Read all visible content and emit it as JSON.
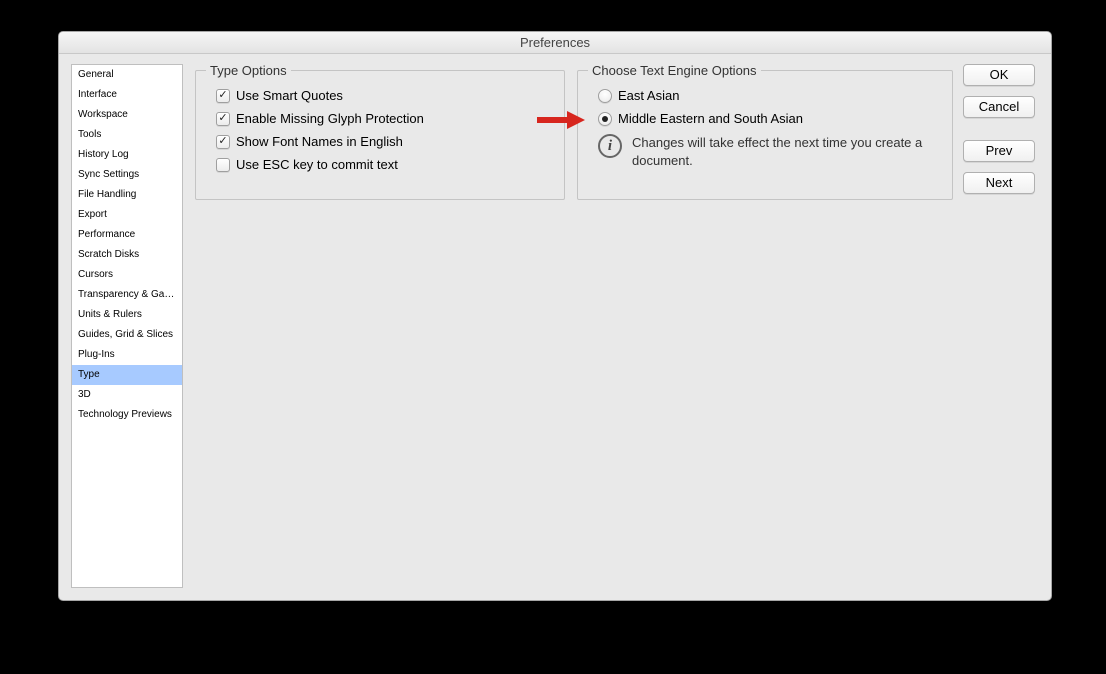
{
  "title": "Preferences",
  "sidebar": {
    "items": [
      {
        "label": "General",
        "selected": false
      },
      {
        "label": "Interface",
        "selected": false
      },
      {
        "label": "Workspace",
        "selected": false
      },
      {
        "label": "Tools",
        "selected": false
      },
      {
        "label": "History Log",
        "selected": false
      },
      {
        "label": "Sync Settings",
        "selected": false
      },
      {
        "label": "File Handling",
        "selected": false
      },
      {
        "label": "Export",
        "selected": false
      },
      {
        "label": "Performance",
        "selected": false
      },
      {
        "label": "Scratch Disks",
        "selected": false
      },
      {
        "label": "Cursors",
        "selected": false
      },
      {
        "label": "Transparency & Gamut",
        "selected": false
      },
      {
        "label": "Units & Rulers",
        "selected": false
      },
      {
        "label": "Guides, Grid & Slices",
        "selected": false
      },
      {
        "label": "Plug-Ins",
        "selected": false
      },
      {
        "label": "Type",
        "selected": true
      },
      {
        "label": "3D",
        "selected": false
      },
      {
        "label": "Technology Previews",
        "selected": false
      }
    ]
  },
  "type_options": {
    "legend": "Type Options",
    "items": [
      {
        "label": "Use Smart Quotes",
        "checked": true
      },
      {
        "label": "Enable Missing Glyph Protection",
        "checked": true
      },
      {
        "label": "Show Font Names in English",
        "checked": true
      },
      {
        "label": "Use ESC key to commit text",
        "checked": false
      }
    ]
  },
  "engine": {
    "legend": "Choose Text Engine Options",
    "options": [
      {
        "label": "East Asian",
        "selected": false
      },
      {
        "label": "Middle Eastern and South Asian",
        "selected": true
      }
    ],
    "info": "Changes will take effect the next time you create a document.",
    "info_glyph": "i"
  },
  "buttons": {
    "ok": "OK",
    "cancel": "Cancel",
    "prev": "Prev",
    "next": "Next"
  },
  "colors": {
    "sidebar_selected": "#a7caff",
    "arrow": "#d7261e"
  }
}
